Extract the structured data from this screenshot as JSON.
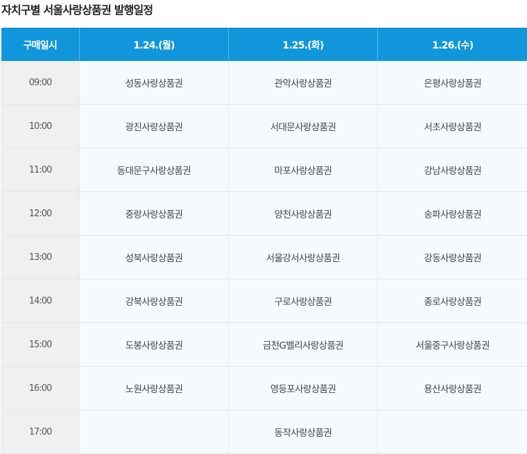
{
  "title": "자치구별 서울사랑상품권 발행일정",
  "headers": [
    "구매일시",
    "1.24.(월)",
    "1.25.(화)",
    "1.26.(수)"
  ],
  "rows": [
    {
      "time": "09:00",
      "cells": [
        "성동사랑상품권",
        "관악사랑상품권",
        "은평사랑상품권"
      ]
    },
    {
      "time": "10:00",
      "cells": [
        "광진사랑상품권",
        "서대문사랑상품권",
        "서초사랑상품권"
      ]
    },
    {
      "time": "11:00",
      "cells": [
        "동대문구사랑상품권",
        "마포사랑상품권",
        "강남사랑상품권"
      ]
    },
    {
      "time": "12:00",
      "cells": [
        "중랑사랑상품권",
        "양천사랑상품권",
        "송파사랑상품권"
      ]
    },
    {
      "time": "13:00",
      "cells": [
        "성북사랑상품권",
        "서울강서사랑상품권",
        "강동사랑상품권"
      ]
    },
    {
      "time": "14:00",
      "cells": [
        "강북사랑상품권",
        "구로사랑상품권",
        "종로사랑상품권"
      ]
    },
    {
      "time": "15:00",
      "cells": [
        "도봉사랑상품권",
        "금천G밸리사랑상품권",
        "서울중구사랑상품권"
      ]
    },
    {
      "time": "16:00",
      "cells": [
        "노원사랑상품권",
        "영등포사랑상품권",
        "용산사랑상품권"
      ]
    },
    {
      "time": "17:00",
      "cells": [
        "",
        "동작사랑상품권",
        ""
      ]
    }
  ]
}
